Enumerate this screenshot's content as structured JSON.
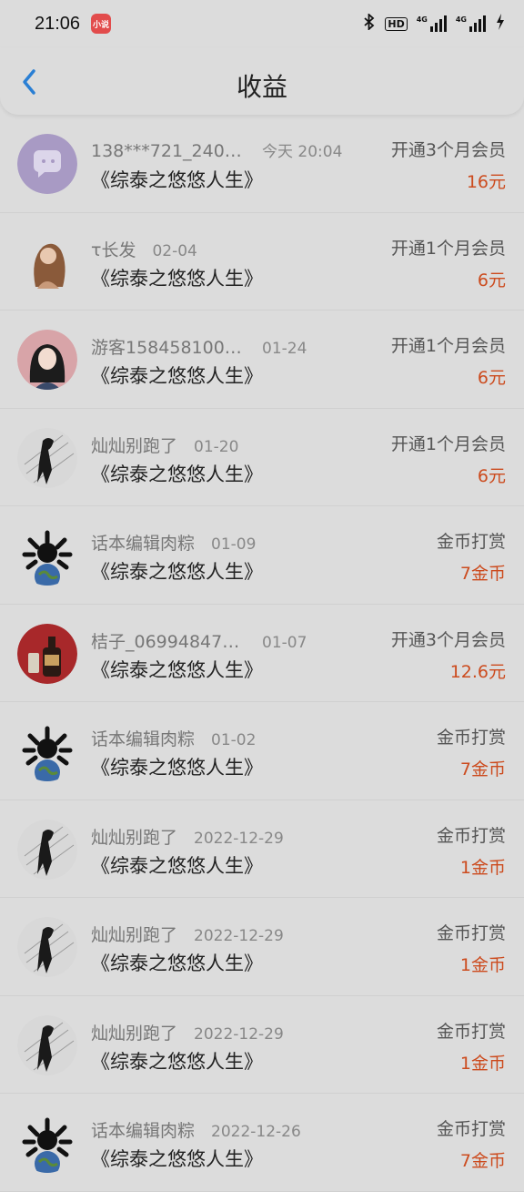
{
  "status_bar": {
    "time": "21:06",
    "app_badge": "小说",
    "hd": "HD",
    "net1": "4G",
    "net2": "4G"
  },
  "header": {
    "title": "收益",
    "back_icon": "chevron-left-icon"
  },
  "items": [
    {
      "user": "138***721_24038...",
      "date": "今天 20:04",
      "book": "《综泰之悠悠人生》",
      "type": "开通3个月会员",
      "amount": "16元",
      "avatar": "chat-bubble"
    },
    {
      "user": "τ长发",
      "date": "02-04",
      "book": "《综泰之悠悠人生》",
      "type": "开通1个月会员",
      "amount": "6元",
      "avatar": "girl"
    },
    {
      "user": "游客15845810021...",
      "date": "01-24",
      "book": "《综泰之悠悠人生》",
      "type": "开通1个月会员",
      "amount": "6元",
      "avatar": "woman"
    },
    {
      "user": "灿灿别跑了",
      "date": "01-20",
      "book": "《综泰之悠悠人生》",
      "type": "开通1个月会员",
      "amount": "6元",
      "avatar": "sketch"
    },
    {
      "user": "话本编辑肉粽",
      "date": "01-09",
      "book": "《综泰之悠悠人生》",
      "type": "金币打赏",
      "amount": "7金币",
      "avatar": "globe"
    },
    {
      "user": "桔子_0699484716...",
      "date": "01-07",
      "book": "《综泰之悠悠人生》",
      "type": "开通3个月会员",
      "amount": "12.6元",
      "avatar": "bottle"
    },
    {
      "user": "话本编辑肉粽",
      "date": "01-02",
      "book": "《综泰之悠悠人生》",
      "type": "金币打赏",
      "amount": "7金币",
      "avatar": "globe"
    },
    {
      "user": "灿灿别跑了",
      "date": "2022-12-29",
      "book": "《综泰之悠悠人生》",
      "type": "金币打赏",
      "amount": "1金币",
      "avatar": "sketch"
    },
    {
      "user": "灿灿别跑了",
      "date": "2022-12-29",
      "book": "《综泰之悠悠人生》",
      "type": "金币打赏",
      "amount": "1金币",
      "avatar": "sketch"
    },
    {
      "user": "灿灿别跑了",
      "date": "2022-12-29",
      "book": "《综泰之悠悠人生》",
      "type": "金币打赏",
      "amount": "1金币",
      "avatar": "sketch"
    },
    {
      "user": "话本编辑肉粽",
      "date": "2022-12-26",
      "book": "《综泰之悠悠人生》",
      "type": "金币打赏",
      "amount": "7金币",
      "avatar": "globe"
    }
  ],
  "colors": {
    "background": "#dcdcdc",
    "amount": "#cc4b1e",
    "back_icon": "#2a7fd4"
  }
}
